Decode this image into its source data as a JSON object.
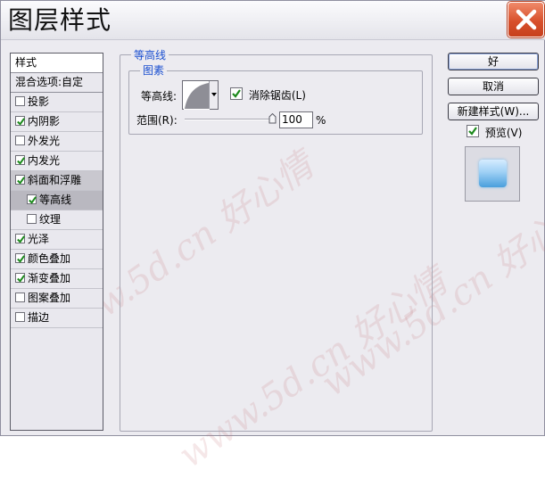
{
  "window": {
    "title": "图层样式",
    "close_icon": "close-icon"
  },
  "styles_list": {
    "header": "样式",
    "blend_options": "混合选项:自定",
    "items": [
      {
        "label": "投影",
        "checked": false
      },
      {
        "label": "内阴影",
        "checked": true
      },
      {
        "label": "外发光",
        "checked": false
      },
      {
        "label": "内发光",
        "checked": true
      },
      {
        "label": "斜面和浮雕",
        "checked": true
      },
      {
        "label": "等高线",
        "checked": true,
        "sub": true,
        "selected": true
      },
      {
        "label": "纹理",
        "checked": false,
        "sub": true
      },
      {
        "label": "光泽",
        "checked": true
      },
      {
        "label": "颜色叠加",
        "checked": true
      },
      {
        "label": "渐变叠加",
        "checked": true
      },
      {
        "label": "图案叠加",
        "checked": false
      },
      {
        "label": "描边",
        "checked": false
      }
    ]
  },
  "contour_panel": {
    "group_title": "等高线",
    "subgroup_title": "图素",
    "contour_label": "等高线:",
    "antialias_label": "消除锯齿(L)",
    "antialias_checked": true,
    "range_label": "范围(R):",
    "range_value": "100",
    "range_unit": "%",
    "range_fraction": 1.0
  },
  "buttons": {
    "ok": "好",
    "cancel": "取消",
    "new_style": "新建样式(W)...",
    "preview_label": "预览(V)",
    "preview_checked": true
  },
  "colors": {
    "accent_text": "#1a4fd0",
    "close_red": "#d8502c",
    "window_bg": "#ecebf0"
  }
}
